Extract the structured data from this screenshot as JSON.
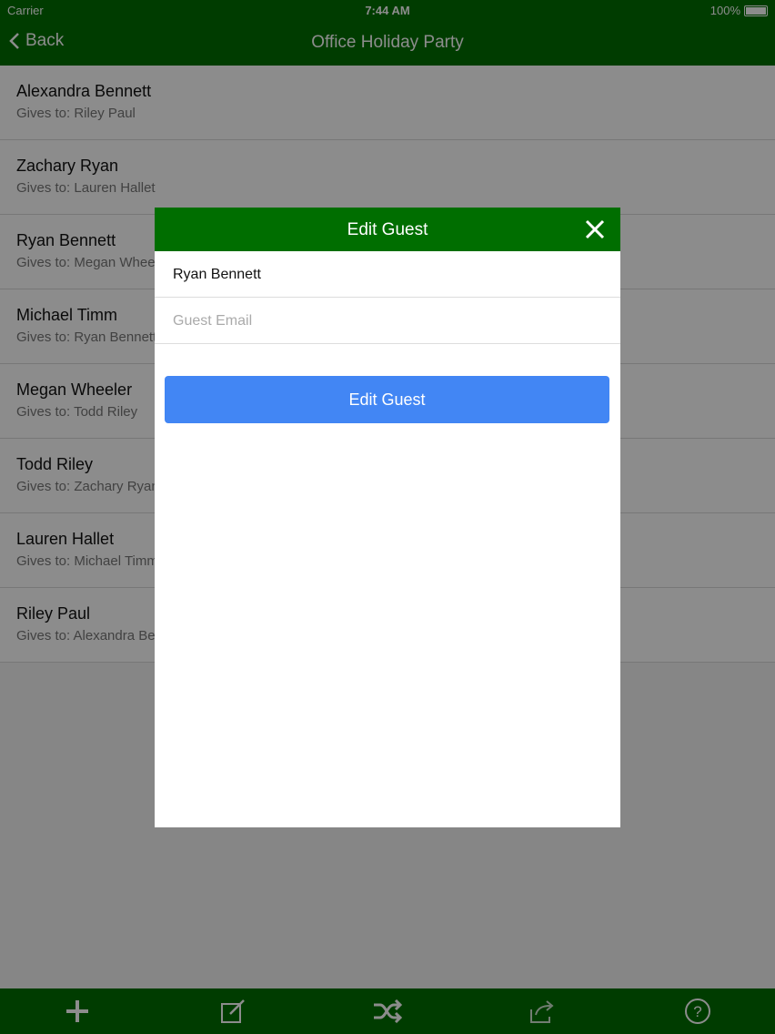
{
  "status_bar": {
    "carrier": "Carrier",
    "time": "7:44 AM",
    "battery": "100%"
  },
  "navbar": {
    "back_label": "Back",
    "title": "Office Holiday Party"
  },
  "guests": [
    {
      "name": "Alexandra Bennett",
      "gives": "Gives to: Riley Paul"
    },
    {
      "name": "Zachary Ryan",
      "gives": "Gives to: Lauren Hallet"
    },
    {
      "name": "Ryan Bennett",
      "gives": "Gives to: Megan Wheeler"
    },
    {
      "name": "Michael Timm",
      "gives": "Gives to: Ryan Bennett"
    },
    {
      "name": "Megan Wheeler",
      "gives": "Gives to: Todd Riley"
    },
    {
      "name": "Todd Riley",
      "gives": "Gives to: Zachary Ryan"
    },
    {
      "name": "Lauren Hallet",
      "gives": "Gives to: Michael Timm"
    },
    {
      "name": "Riley Paul",
      "gives": "Gives to: Alexandra Bennett"
    }
  ],
  "modal": {
    "title": "Edit Guest",
    "name_value": "Ryan Bennett",
    "email_placeholder": "Guest Email",
    "email_value": "",
    "submit_label": "Edit Guest"
  },
  "tabbar": {
    "icons": [
      "add-icon",
      "edit-icon",
      "shuffle-icon",
      "share-icon",
      "help-icon"
    ]
  },
  "colors": {
    "brand_green": "#006e00",
    "button_blue": "#4286f4"
  }
}
